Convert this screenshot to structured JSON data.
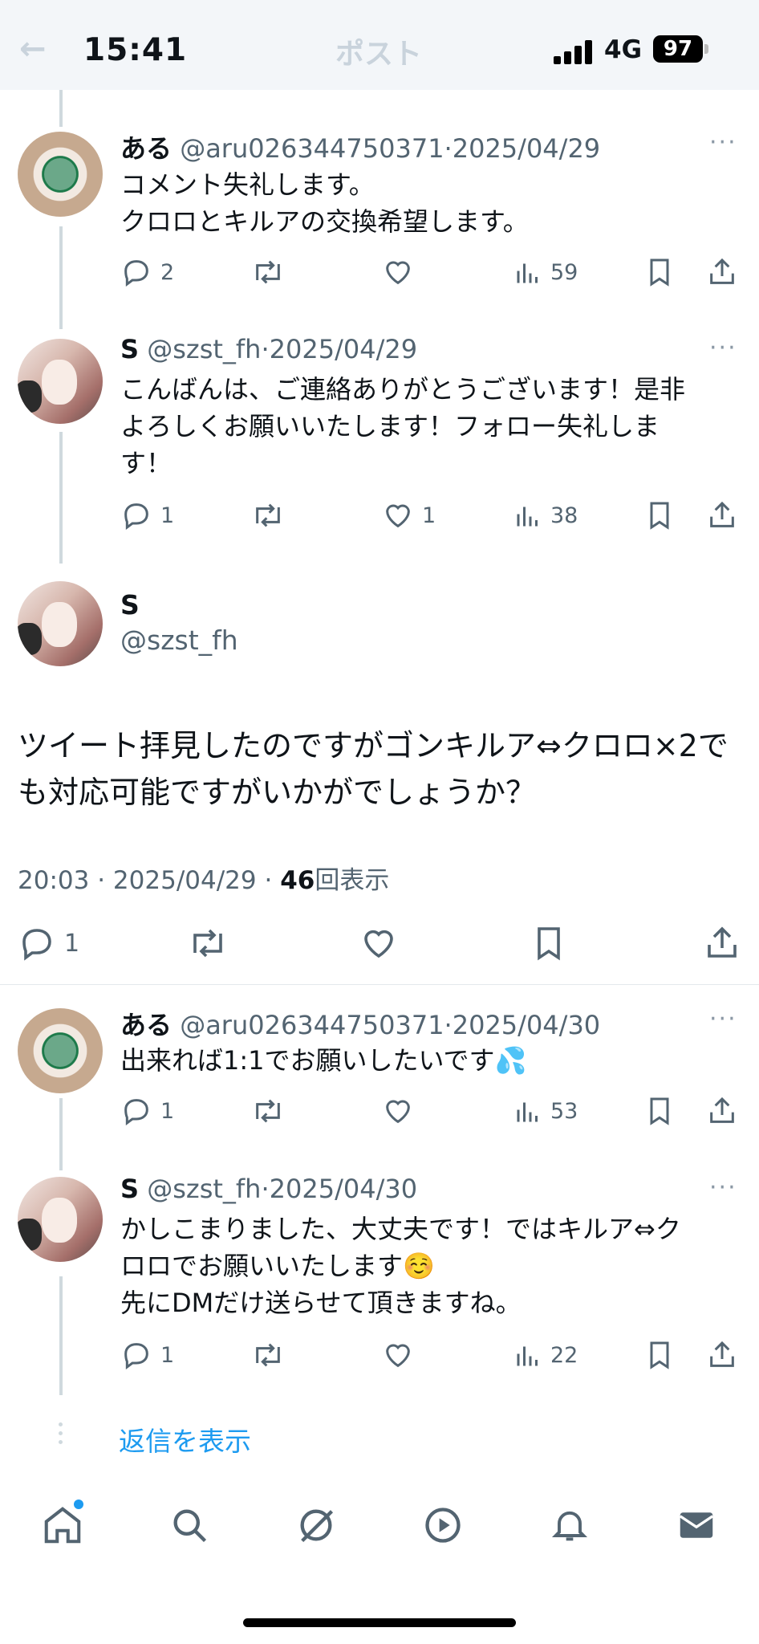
{
  "status_bar": {
    "time": "15:41",
    "network": "4G",
    "battery": "97",
    "faded_title": "ポスト"
  },
  "replies_before": [
    {
      "name": "ある",
      "handle": "@aru026344750371",
      "date": "2025/04/29",
      "lines": [
        "コメント失礼します。",
        "クロロとキルアの交換希望します。"
      ],
      "reply_count": "2",
      "retweet_count": "",
      "like_count": "",
      "views": "59",
      "avatar": "starbucks-avatar"
    },
    {
      "name": "S",
      "handle": "@szst_fh",
      "date": "2025/04/29",
      "lines": [
        "こんばんは、ご連絡ありがとうございます！是非",
        "よろしくお願いいたします！フォロー失礼しま",
        "す！"
      ],
      "reply_count": "1",
      "retweet_count": "",
      "like_count": "1",
      "views": "38",
      "avatar": "girl-avatar"
    }
  ],
  "main_post": {
    "name": "S",
    "handle": "@szst_fh",
    "lines": [
      "ツイート拝見したのですがゴンキルア⇔クロロ×2で",
      "も対応可能ですがいかがでしょうか？"
    ],
    "time": "20:03",
    "date": "2025/04/29",
    "views": "46",
    "views_label": "回表示",
    "reply_count": "1"
  },
  "replies_after": [
    {
      "name": "ある",
      "handle": "@aru026344750371",
      "date": "2025/04/30",
      "lines": [
        "出来れば1:1でお願いしたいです💦"
      ],
      "reply_count": "1",
      "retweet_count": "",
      "like_count": "",
      "views": "53"
    },
    {
      "name": "S",
      "handle": "@szst_fh",
      "date": "2025/04/30",
      "lines": [
        "かしこまりました、大丈夫です！ではキルア⇔ク",
        "ロロでお願いいたします☺️",
        "先にDMだけ送らせて頂きますね。"
      ],
      "reply_count": "1",
      "retweet_count": "",
      "like_count": "",
      "views": "22"
    }
  ],
  "show_replies": "返信を表示",
  "separator": "·",
  "more": "···",
  "tabs": [
    "home-icon",
    "search-icon",
    "grok-icon",
    "video-icon",
    "notifications-icon",
    "messages-icon"
  ],
  "colors": {
    "accent": "#1d9bf0",
    "secondary_text": "#536471"
  }
}
